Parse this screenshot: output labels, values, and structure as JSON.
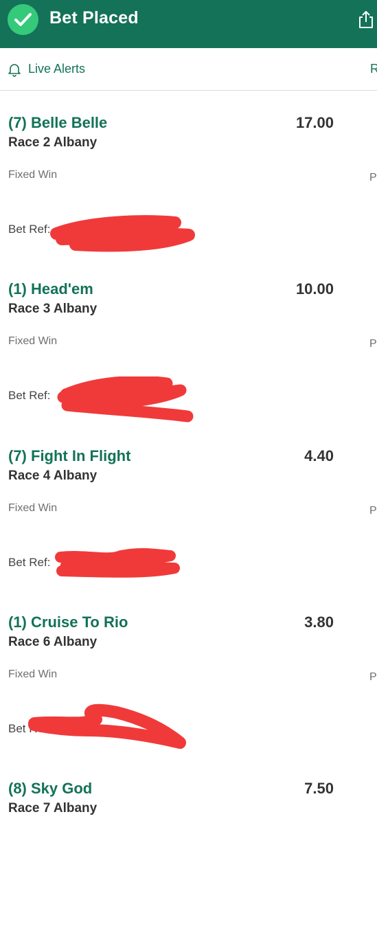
{
  "header": {
    "title": "Bet Placed",
    "check_icon": "check-circle-icon",
    "share_icon": "share-icon"
  },
  "alerts": {
    "label": "Live Alerts",
    "right_partial": "R",
    "bell_icon": "bell-icon"
  },
  "colors": {
    "brand_green": "#137257",
    "check_green": "#35c97a",
    "redaction_red": "#f03a3a"
  },
  "bets": [
    {
      "selection": "(7) Belle Belle",
      "odds": "17.00",
      "race": "Race 2 Albany",
      "bet_type": "Fixed Win",
      "ref_label": "Bet Ref:",
      "edge_partial": "P"
    },
    {
      "selection": "(1) Head'em",
      "odds": "10.00",
      "race": "Race 3 Albany",
      "bet_type": "Fixed Win",
      "ref_label": "Bet Ref:",
      "edge_partial": "P"
    },
    {
      "selection": "(7) Fight In Flight",
      "odds": "4.40",
      "race": "Race 4 Albany",
      "bet_type": "Fixed Win",
      "ref_label": "Bet Ref:",
      "edge_partial": "P"
    },
    {
      "selection": "(1) Cruise To Rio",
      "odds": "3.80",
      "race": "Race 6 Albany",
      "bet_type": "Fixed Win",
      "ref_label": "Bet Ref:",
      "edge_partial": "P"
    },
    {
      "selection": "(8) Sky God",
      "odds": "7.50",
      "race": "Race 7 Albany",
      "bet_type": "",
      "ref_label": "",
      "edge_partial": ""
    }
  ]
}
